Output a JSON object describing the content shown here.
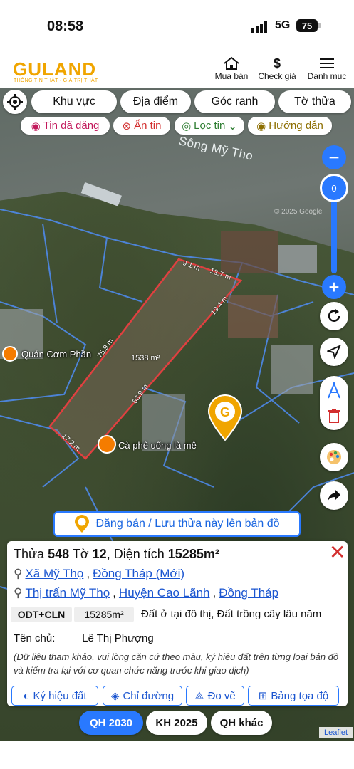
{
  "status": {
    "time": "08:58",
    "network": "5G",
    "battery": "75"
  },
  "app": {
    "logo": "GULAND",
    "logo_sub": "THÔNG TIN THẬT · GIÁ TRỊ THẬT",
    "nav": [
      {
        "label": "Mua bán",
        "icon": "house-icon"
      },
      {
        "label": "Check giá",
        "icon": "dollar-icon"
      },
      {
        "label": "Danh mục",
        "icon": "menu-icon"
      }
    ]
  },
  "filters": {
    "tabs": [
      "Khu vực",
      "Địa điểm",
      "Góc ranh",
      "Tờ thửa"
    ],
    "chips": [
      {
        "label": "Tin đã đăng",
        "color": "#c2185b"
      },
      {
        "label": "Ẩn tin",
        "color": "#d32f2f"
      },
      {
        "label": "Lọc tin",
        "color": "#2e7d32"
      },
      {
        "label": "Hướng dẫn",
        "color": "#8d6e00"
      }
    ]
  },
  "map": {
    "river_label": "Sông Mỹ Tho",
    "zoom_value": "0",
    "places": [
      "Quán Cơm Phần",
      "Cà phê uống là mê"
    ],
    "parcel_area": "1538 m²",
    "dimensions": [
      "9.1 m",
      "13.7 m",
      "19.4 m",
      "75.9 m",
      "63.9 m",
      "17.2 m"
    ],
    "post_button": "Đăng bán / Lưu thửa này lên bản đồ",
    "attribution": "Leaflet",
    "copyright": "© 2025 Google"
  },
  "parcel": {
    "thua_label": "Thửa",
    "thua": "548",
    "to_label": "Tờ",
    "to": "12",
    "area_label": "Diện tích",
    "area": "15285m²",
    "location_new": [
      "Xã Mỹ Thọ",
      "Đồng Tháp (Mới)"
    ],
    "location_old": [
      "Thị trấn Mỹ Thọ",
      "Huyện Cao Lãnh",
      "Đồng Tháp"
    ],
    "land_code": "ODT+CLN",
    "land_area": "15285m²",
    "land_desc": "Đất ở tại đô thị, Đất trồng cây lâu năm",
    "owner_label": "Tên chủ:",
    "owner": "Lê Thị Phượng",
    "note": "(Dữ liệu tham khảo, vui lòng căn cứ theo màu, ký hiệu đất trên từng loại bản đồ và kiểm tra lại với cơ quan chức năng trước khi giao dịch)",
    "actions": [
      "Ký hiệu đất",
      "Chỉ đường",
      "Đo vẽ",
      "Bảng tọa độ"
    ]
  },
  "layers": [
    "QH 2030",
    "KH 2025",
    "QH khác"
  ]
}
